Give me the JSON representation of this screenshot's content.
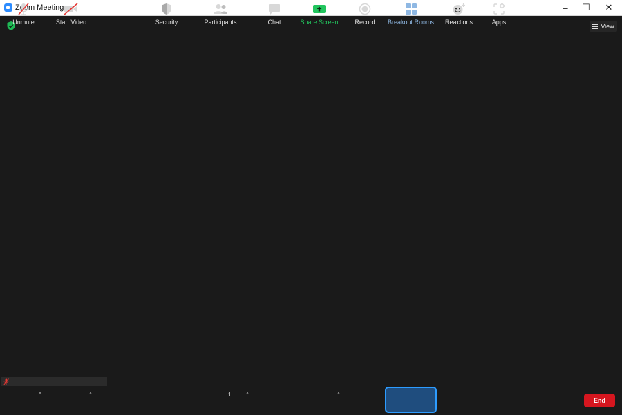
{
  "window": {
    "title": "Zoom Meeting",
    "minimize": "–",
    "maximize": "☐",
    "close": "✕"
  },
  "stage": {
    "view_label": "View"
  },
  "toolbar": {
    "unmute": "Unmute",
    "start_video": "Start Video",
    "security": "Security",
    "participants": "Participants",
    "participant_count": "1",
    "chat": "Chat",
    "share_screen": "Share Screen",
    "record": "Record",
    "breakout_rooms": "Breakout Rooms",
    "reactions": "Reactions",
    "apps": "Apps",
    "end": "End"
  },
  "colors": {
    "accent_blue": "#2d9cff",
    "share_green": "#22c55e",
    "end_red": "#d6161f",
    "muted_red": "#e53935"
  },
  "icons": [
    "shield-icon",
    "grid-icon",
    "mic-muted-icon",
    "video-off-icon",
    "security-shield-icon",
    "participants-icon",
    "chat-icon",
    "share-screen-icon",
    "record-icon",
    "breakout-rooms-icon",
    "reactions-icon",
    "apps-icon"
  ]
}
